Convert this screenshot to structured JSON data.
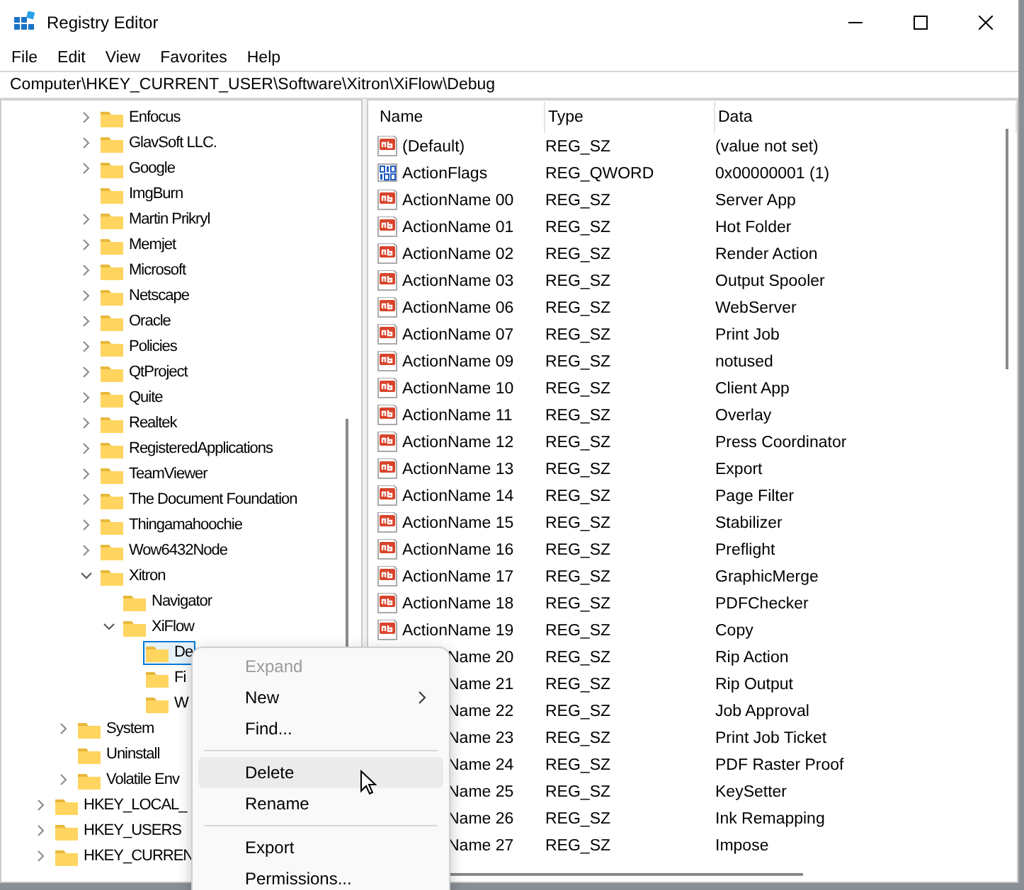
{
  "window": {
    "title": "Registry Editor"
  },
  "menu_bar": [
    "File",
    "Edit",
    "View",
    "Favorites",
    "Help"
  ],
  "address": "Computer\\HKEY_CURRENT_USER\\Software\\Xitron\\XiFlow\\Debug",
  "tree": {
    "items": [
      {
        "children": [
          {
            "children": [
              {
                "label": "Enfocus",
                "expanded": false,
                "selected": false
              },
              {
                "label": "GlavSoft LLC.",
                "expanded": false,
                "selected": false
              },
              {
                "label": "Google",
                "expanded": false,
                "selected": false
              },
              {
                "label": "ImgBurn",
                "selected": false
              },
              {
                "label": "Martin Prikryl",
                "expanded": false,
                "selected": false
              },
              {
                "label": "Memjet",
                "expanded": false,
                "selected": false
              },
              {
                "label": "Microsoft",
                "expanded": false,
                "selected": false
              },
              {
                "label": "Netscape",
                "expanded": false,
                "selected": false
              },
              {
                "label": "Oracle",
                "expanded": false,
                "selected": false
              },
              {
                "label": "Policies",
                "expanded": false,
                "selected": false
              },
              {
                "label": "QtProject",
                "expanded": false,
                "selected": false
              },
              {
                "label": "Quite",
                "expanded": false,
                "selected": false
              },
              {
                "label": "Realtek",
                "expanded": false,
                "selected": false
              },
              {
                "label": "RegisteredApplications",
                "expanded": false,
                "selected": false
              },
              {
                "label": "TeamViewer",
                "expanded": false,
                "selected": false
              },
              {
                "label": "The Document Foundation",
                "expanded": false,
                "selected": false
              },
              {
                "label": "Thingamahoochie",
                "expanded": false,
                "selected": false
              },
              {
                "label": "Wow6432Node",
                "expanded": false,
                "selected": false
              },
              {
                "label": "Xitron",
                "expanded": true,
                "selected": false,
                "children": [
                  {
                    "label": "Navigator",
                    "selected": false
                  },
                  {
                    "label": "XiFlow",
                    "expanded": true,
                    "selected": false,
                    "children": [
                      {
                        "label": "De",
                        "selected": true
                      },
                      {
                        "label": "Fi",
                        "selected": false
                      },
                      {
                        "label": "W",
                        "selected": false
                      }
                    ]
                  }
                ]
              }
            ]
          },
          {
            "label": "System",
            "expanded": false,
            "selected": false
          },
          {
            "label": "Uninstall",
            "selected": false
          },
          {
            "label": "Volatile Env",
            "expanded": false,
            "selected": false
          }
        ]
      },
      {
        "label": "HKEY_LOCAL_",
        "expanded": false,
        "selected": false
      },
      {
        "label": "HKEY_USERS",
        "expanded": false,
        "selected": false
      },
      {
        "label": "HKEY_CURREN",
        "expanded": false,
        "selected": false
      }
    ]
  },
  "values": {
    "columns": [
      "Name",
      "Type",
      "Data"
    ],
    "rows": [
      {
        "kind": "string",
        "name": "(Default)",
        "type": "REG_SZ",
        "data": "(value not set)"
      },
      {
        "kind": "binary",
        "name": "ActionFlags",
        "type": "REG_QWORD",
        "data": "0x00000001 (1)"
      },
      {
        "kind": "string",
        "name": "ActionName 00",
        "type": "REG_SZ",
        "data": "Server App"
      },
      {
        "kind": "string",
        "name": "ActionName 01",
        "type": "REG_SZ",
        "data": "Hot Folder"
      },
      {
        "kind": "string",
        "name": "ActionName 02",
        "type": "REG_SZ",
        "data": "Render Action"
      },
      {
        "kind": "string",
        "name": "ActionName 03",
        "type": "REG_SZ",
        "data": "Output Spooler"
      },
      {
        "kind": "string",
        "name": "ActionName 06",
        "type": "REG_SZ",
        "data": "WebServer"
      },
      {
        "kind": "string",
        "name": "ActionName 07",
        "type": "REG_SZ",
        "data": "Print Job"
      },
      {
        "kind": "string",
        "name": "ActionName 09",
        "type": "REG_SZ",
        "data": "notused"
      },
      {
        "kind": "string",
        "name": "ActionName 10",
        "type": "REG_SZ",
        "data": "Client App"
      },
      {
        "kind": "string",
        "name": "ActionName 11",
        "type": "REG_SZ",
        "data": "Overlay"
      },
      {
        "kind": "string",
        "name": "ActionName 12",
        "type": "REG_SZ",
        "data": "Press Coordinator"
      },
      {
        "kind": "string",
        "name": "ActionName 13",
        "type": "REG_SZ",
        "data": "Export"
      },
      {
        "kind": "string",
        "name": "ActionName 14",
        "type": "REG_SZ",
        "data": "Page Filter"
      },
      {
        "kind": "string",
        "name": "ActionName 15",
        "type": "REG_SZ",
        "data": "Stabilizer"
      },
      {
        "kind": "string",
        "name": "ActionName 16",
        "type": "REG_SZ",
        "data": "Preflight"
      },
      {
        "kind": "string",
        "name": "ActionName 17",
        "type": "REG_SZ",
        "data": "GraphicMerge"
      },
      {
        "kind": "string",
        "name": "ActionName 18",
        "type": "REG_SZ",
        "data": "PDFChecker"
      },
      {
        "kind": "string",
        "name": "ActionName 19",
        "type": "REG_SZ",
        "data": "Copy"
      },
      {
        "kind": "covered",
        "name": "Name 20",
        "type": "REG_SZ",
        "data": "Rip Action"
      },
      {
        "kind": "covered",
        "name": "Name 21",
        "type": "REG_SZ",
        "data": "Rip Output"
      },
      {
        "kind": "covered",
        "name": "Name 22",
        "type": "REG_SZ",
        "data": "Job Approval"
      },
      {
        "kind": "covered",
        "name": "Name 23",
        "type": "REG_SZ",
        "data": "Print Job Ticket"
      },
      {
        "kind": "covered",
        "name": "Name 24",
        "type": "REG_SZ",
        "data": "PDF Raster Proof"
      },
      {
        "kind": "covered",
        "name": "Name 25",
        "type": "REG_SZ",
        "data": "KeySetter"
      },
      {
        "kind": "covered",
        "name": "Name 26",
        "type": "REG_SZ",
        "data": "Ink Remapping"
      },
      {
        "kind": "covered",
        "name": "Name 27",
        "type": "REG_SZ",
        "data": "Impose"
      }
    ]
  },
  "context_menu": [
    {
      "kind": "item",
      "label": "Expand",
      "disabled": true,
      "highlighted": false
    },
    {
      "kind": "submenu",
      "label": "New",
      "disabled": false,
      "highlighted": false
    },
    {
      "kind": "item",
      "label": "Find...",
      "disabled": false,
      "highlighted": false
    },
    {
      "kind": "separator"
    },
    {
      "kind": "item",
      "label": "Delete",
      "disabled": false,
      "highlighted": true
    },
    {
      "kind": "item",
      "label": "Rename",
      "disabled": false,
      "highlighted": false
    },
    {
      "kind": "separator"
    },
    {
      "kind": "item",
      "label": "Export",
      "disabled": false,
      "highlighted": false
    },
    {
      "kind": "item",
      "label": "Permissions...",
      "disabled": false,
      "highlighted": false
    }
  ]
}
